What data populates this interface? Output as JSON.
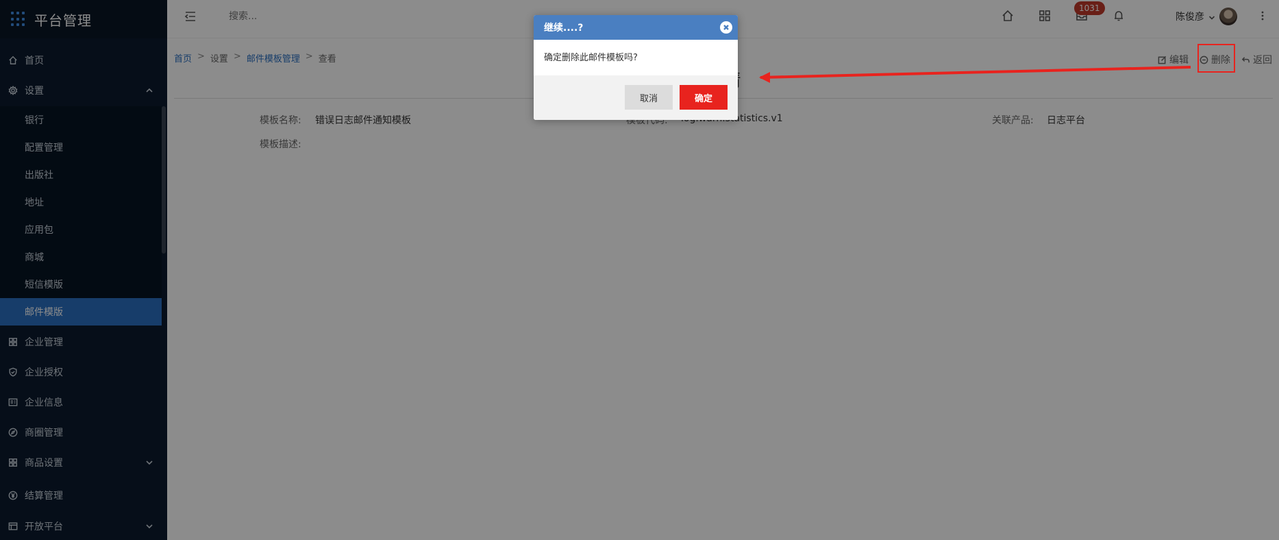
{
  "app": {
    "title": "平台管理"
  },
  "sidebar": {
    "items": [
      {
        "label": "首页",
        "icon": "home-icon"
      },
      {
        "label": "设置",
        "icon": "gear-icon"
      },
      {
        "label": "企业管理",
        "icon": "building-icon"
      },
      {
        "label": "企业授权",
        "icon": "shield-icon"
      },
      {
        "label": "企业信息",
        "icon": "info-card-icon"
      },
      {
        "label": "商圈管理",
        "icon": "compass-icon"
      },
      {
        "label": "商品设置",
        "icon": "grid-icon"
      },
      {
        "label": "结算管理",
        "icon": "yen-icon"
      },
      {
        "label": "开放平台",
        "icon": "table-icon"
      }
    ],
    "settings_sub": [
      {
        "label": "银行"
      },
      {
        "label": "配置管理"
      },
      {
        "label": "出版社"
      },
      {
        "label": "地址"
      },
      {
        "label": "应用包"
      },
      {
        "label": "商城"
      },
      {
        "label": "短信模版"
      },
      {
        "label": "邮件模版"
      }
    ]
  },
  "topbar": {
    "search_placeholder": "搜索...",
    "badge_count": "1031",
    "user_name": "陈俊彦"
  },
  "breadcrumb": {
    "home": "首页",
    "sep": ">",
    "settings": "设置",
    "mail_tpl_mgmt": "邮件模板管理",
    "view": "查看"
  },
  "actions": {
    "edit": "编辑",
    "delete": "删除",
    "back": "返回"
  },
  "page": {
    "title": "详情",
    "fields": {
      "tpl_name_label": "模板名称:",
      "tpl_name_value": "错误日志邮件通知模板",
      "tpl_code_label": "模板代码:",
      "tpl_code_value": "log.warn.statistics.v1",
      "product_label": "关联产品:",
      "product_value": "日志平台",
      "desc_label": "模板描述:"
    }
  },
  "modal": {
    "title": "继续....?",
    "message": "确定删除此邮件模板吗?",
    "cancel": "取消",
    "ok": "确定"
  },
  "colors": {
    "sidebar_bg": "#0b1b2e",
    "active": "#2a6fc1",
    "modal_header": "#4a7fc1",
    "danger": "#e8231e"
  }
}
